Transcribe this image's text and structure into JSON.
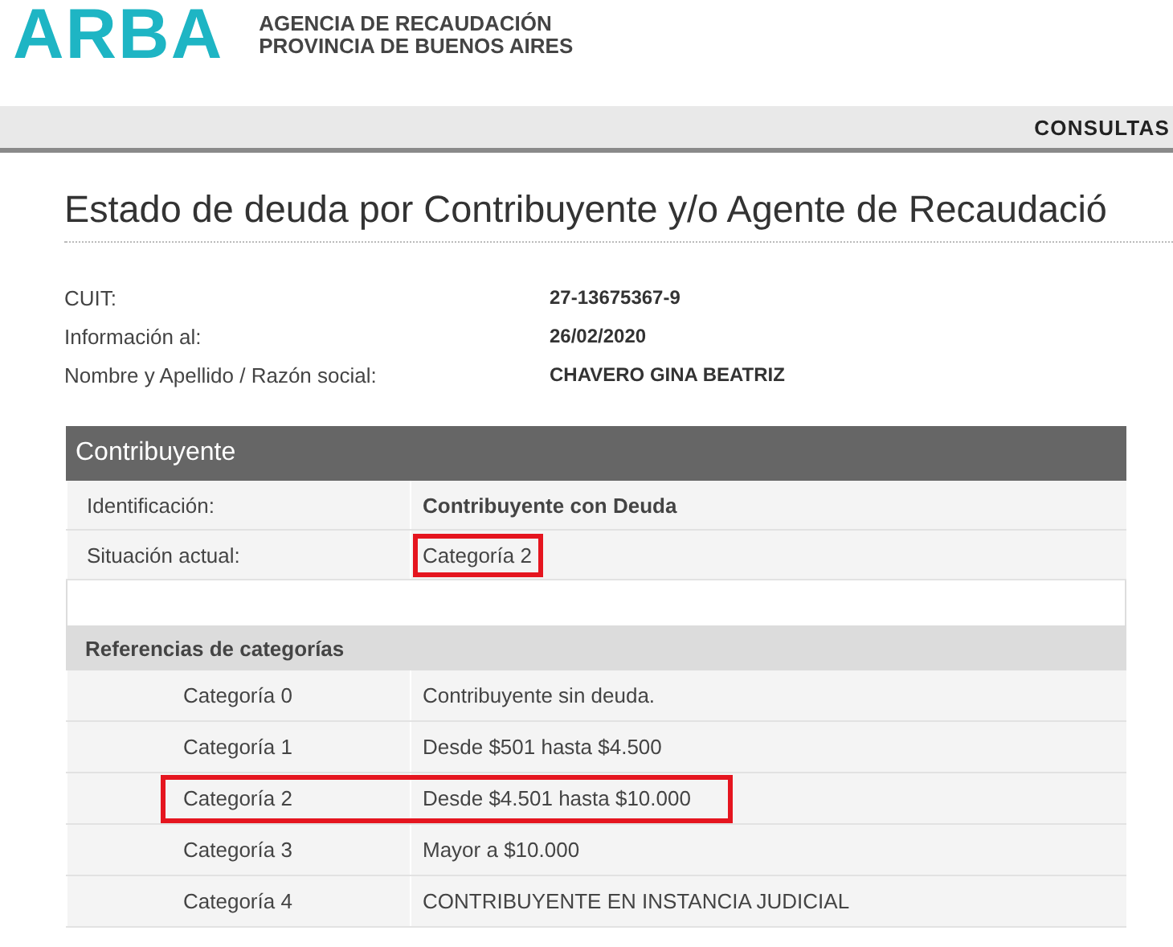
{
  "header": {
    "logo": "ARBA",
    "agency_lines": [
      "AGENCIA DE RECAUDACIÓN",
      "PROVINCIA DE BUENOS AIRES"
    ]
  },
  "nav": {
    "items": [
      "CONSULTAS"
    ]
  },
  "title": "Estado de deuda por Contribuyente y/o Agente de Recaudació",
  "info": [
    {
      "label": "CUIT:",
      "value": "27-13675367-9"
    },
    {
      "label": "Información al:",
      "value": "26/02/2020"
    },
    {
      "label": "Nombre y Apellido / Razón social:",
      "value": "CHAVERO GINA BEATRIZ"
    }
  ],
  "contribuyente": {
    "heading": "Contribuyente",
    "rows": [
      {
        "label": "Identificación:",
        "value": "Contribuyente con Deuda",
        "bold": true,
        "highlighted": false
      },
      {
        "label": "Situación actual:",
        "value": "Categoría 2",
        "bold": false,
        "highlighted": true
      }
    ]
  },
  "referencias": {
    "heading": "Referencias de categorías",
    "rows": [
      {
        "category": "Categoría 0",
        "description": "Contribuyente sin deuda.",
        "highlighted": false
      },
      {
        "category": "Categoría 1",
        "description": "Desde $501 hasta $4.500",
        "highlighted": false
      },
      {
        "category": "Categoría 2",
        "description": "Desde $4.501 hasta $10.000",
        "highlighted": true
      },
      {
        "category": "Categoría 3",
        "description": "Mayor a $10.000",
        "highlighted": false
      },
      {
        "category": "Categoría 4",
        "description": "CONTRIBUYENTE EN INSTANCIA JUDICIAL",
        "highlighted": false
      }
    ]
  }
}
